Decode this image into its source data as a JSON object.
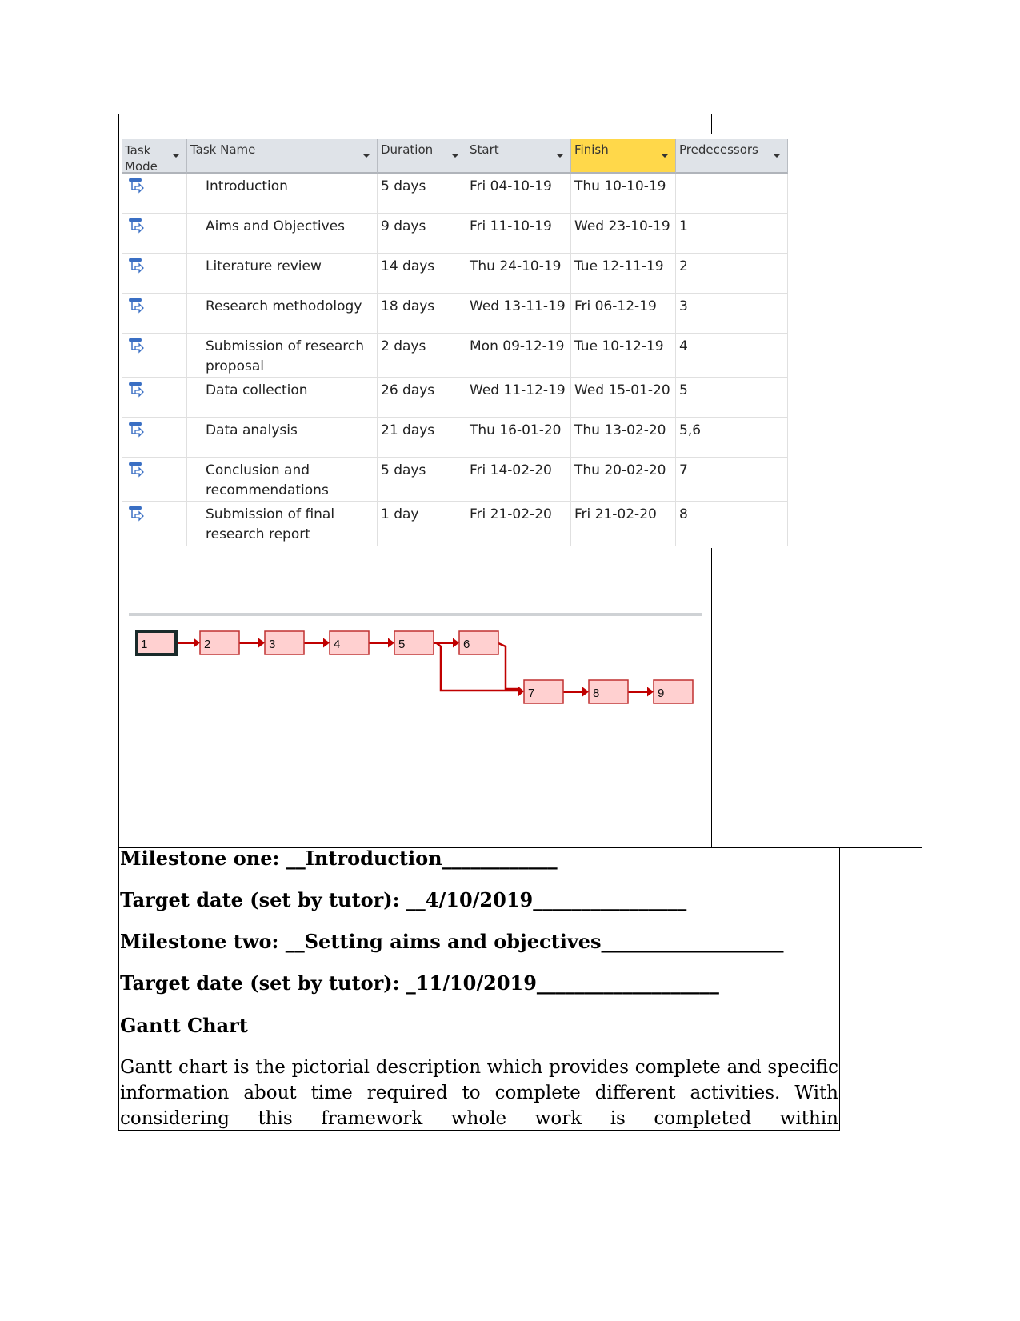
{
  "table": {
    "headers": [
      "Task Mode",
      "Task Name",
      "Duration",
      "Start",
      "Finish",
      "Predecessors"
    ],
    "rows": [
      {
        "name": "Introduction",
        "duration": "5 days",
        "start": "Fri 04-10-19",
        "finish": "Thu 10-10-19",
        "pred": ""
      },
      {
        "name": "Aims and Objectives",
        "duration": "9 days",
        "start": "Fri 11-10-19",
        "finish": "Wed 23-10-19",
        "pred": "1"
      },
      {
        "name": "Literature review",
        "duration": "14 days",
        "start": "Thu 24-10-19",
        "finish": "Tue 12-11-19",
        "pred": "2"
      },
      {
        "name": "Research methodology",
        "duration": "18 days",
        "start": "Wed 13-11-19",
        "finish": "Fri 06-12-19",
        "pred": "3"
      },
      {
        "name": "Submission of research proposal",
        "duration": "2 days",
        "start": "Mon 09-12-19",
        "finish": "Tue 10-12-19",
        "pred": "4"
      },
      {
        "name": "Data collection",
        "duration": "26 days",
        "start": "Wed 11-12-19",
        "finish": "Wed 15-01-20",
        "pred": "5"
      },
      {
        "name": "Data analysis",
        "duration": "21 days",
        "start": "Thu 16-01-20",
        "finish": "Thu 13-02-20",
        "pred": "5,6"
      },
      {
        "name": "Conclusion and recommendations",
        "duration": "5 days",
        "start": "Fri 14-02-20",
        "finish": "Thu 20-02-20",
        "pred": "7"
      },
      {
        "name": "Submission of final research report",
        "duration": "1 day",
        "start": "Fri 21-02-20",
        "finish": "Fri 21-02-20",
        "pred": "8"
      }
    ],
    "mode_icon": "auto-scheduled-task-icon",
    "finish_highlight": "#ffd84a"
  },
  "network": {
    "nodes": [
      "1",
      "2",
      "3",
      "4",
      "5",
      "6",
      "7",
      "8",
      "9"
    ],
    "links": [
      [
        "1",
        "2"
      ],
      [
        "2",
        "3"
      ],
      [
        "3",
        "4"
      ],
      [
        "4",
        "5"
      ],
      [
        "5",
        "6"
      ],
      [
        "5",
        "7"
      ],
      [
        "6",
        "7"
      ],
      [
        "7",
        "8"
      ],
      [
        "8",
        "9"
      ]
    ],
    "color": "#c00000",
    "fill": "#ffd0d0"
  },
  "milestones": {
    "m1": "Milestone one:  __Introduction____________",
    "d1": "Target date (set by tutor): __4/10/2019________________",
    "m2": "Milestone two: __Setting aims and objectives___________________",
    "d2": "Target date (set by tutor): _11/10/2019___________________"
  },
  "gantt": {
    "heading": "Gantt Chart",
    "paragraph": "Gantt chart is the pictorial description which provides complete and specific information about time required to complete different activities. With considering this framework whole work is completed within"
  }
}
